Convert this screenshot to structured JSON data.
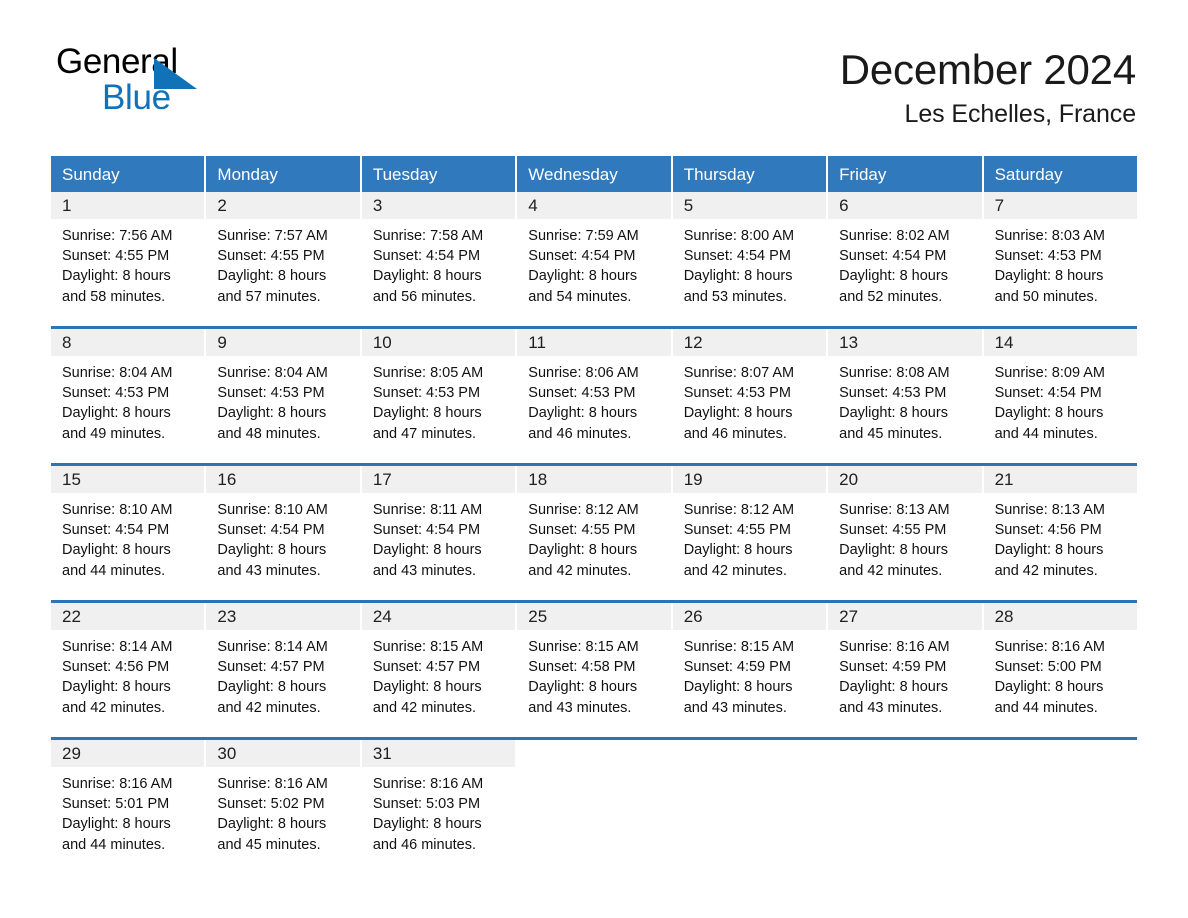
{
  "logo": {
    "text_primary": "General",
    "text_secondary": "Blue",
    "primary_color": "#000000",
    "secondary_color": "#1272b8"
  },
  "header": {
    "title": "December 2024",
    "subtitle": "Les Echelles, France"
  },
  "theme": {
    "header_blue": "#3079bd",
    "rule_blue": "#2e74b5",
    "daynum_band": "#f0f0f0",
    "text": "#111111"
  },
  "calendar": {
    "day_headers": [
      "Sunday",
      "Monday",
      "Tuesday",
      "Wednesday",
      "Thursday",
      "Friday",
      "Saturday"
    ],
    "weeks": [
      [
        {
          "day": "1",
          "sunrise": "Sunrise: 7:56 AM",
          "sunset": "Sunset: 4:55 PM",
          "daylight_line1": "Daylight: 8 hours",
          "daylight_line2": "and 58 minutes."
        },
        {
          "day": "2",
          "sunrise": "Sunrise: 7:57 AM",
          "sunset": "Sunset: 4:55 PM",
          "daylight_line1": "Daylight: 8 hours",
          "daylight_line2": "and 57 minutes."
        },
        {
          "day": "3",
          "sunrise": "Sunrise: 7:58 AM",
          "sunset": "Sunset: 4:54 PM",
          "daylight_line1": "Daylight: 8 hours",
          "daylight_line2": "and 56 minutes."
        },
        {
          "day": "4",
          "sunrise": "Sunrise: 7:59 AM",
          "sunset": "Sunset: 4:54 PM",
          "daylight_line1": "Daylight: 8 hours",
          "daylight_line2": "and 54 minutes."
        },
        {
          "day": "5",
          "sunrise": "Sunrise: 8:00 AM",
          "sunset": "Sunset: 4:54 PM",
          "daylight_line1": "Daylight: 8 hours",
          "daylight_line2": "and 53 minutes."
        },
        {
          "day": "6",
          "sunrise": "Sunrise: 8:02 AM",
          "sunset": "Sunset: 4:54 PM",
          "daylight_line1": "Daylight: 8 hours",
          "daylight_line2": "and 52 minutes."
        },
        {
          "day": "7",
          "sunrise": "Sunrise: 8:03 AM",
          "sunset": "Sunset: 4:53 PM",
          "daylight_line1": "Daylight: 8 hours",
          "daylight_line2": "and 50 minutes."
        }
      ],
      [
        {
          "day": "8",
          "sunrise": "Sunrise: 8:04 AM",
          "sunset": "Sunset: 4:53 PM",
          "daylight_line1": "Daylight: 8 hours",
          "daylight_line2": "and 49 minutes."
        },
        {
          "day": "9",
          "sunrise": "Sunrise: 8:04 AM",
          "sunset": "Sunset: 4:53 PM",
          "daylight_line1": "Daylight: 8 hours",
          "daylight_line2": "and 48 minutes."
        },
        {
          "day": "10",
          "sunrise": "Sunrise: 8:05 AM",
          "sunset": "Sunset: 4:53 PM",
          "daylight_line1": "Daylight: 8 hours",
          "daylight_line2": "and 47 minutes."
        },
        {
          "day": "11",
          "sunrise": "Sunrise: 8:06 AM",
          "sunset": "Sunset: 4:53 PM",
          "daylight_line1": "Daylight: 8 hours",
          "daylight_line2": "and 46 minutes."
        },
        {
          "day": "12",
          "sunrise": "Sunrise: 8:07 AM",
          "sunset": "Sunset: 4:53 PM",
          "daylight_line1": "Daylight: 8 hours",
          "daylight_line2": "and 46 minutes."
        },
        {
          "day": "13",
          "sunrise": "Sunrise: 8:08 AM",
          "sunset": "Sunset: 4:53 PM",
          "daylight_line1": "Daylight: 8 hours",
          "daylight_line2": "and 45 minutes."
        },
        {
          "day": "14",
          "sunrise": "Sunrise: 8:09 AM",
          "sunset": "Sunset: 4:54 PM",
          "daylight_line1": "Daylight: 8 hours",
          "daylight_line2": "and 44 minutes."
        }
      ],
      [
        {
          "day": "15",
          "sunrise": "Sunrise: 8:10 AM",
          "sunset": "Sunset: 4:54 PM",
          "daylight_line1": "Daylight: 8 hours",
          "daylight_line2": "and 44 minutes."
        },
        {
          "day": "16",
          "sunrise": "Sunrise: 8:10 AM",
          "sunset": "Sunset: 4:54 PM",
          "daylight_line1": "Daylight: 8 hours",
          "daylight_line2": "and 43 minutes."
        },
        {
          "day": "17",
          "sunrise": "Sunrise: 8:11 AM",
          "sunset": "Sunset: 4:54 PM",
          "daylight_line1": "Daylight: 8 hours",
          "daylight_line2": "and 43 minutes."
        },
        {
          "day": "18",
          "sunrise": "Sunrise: 8:12 AM",
          "sunset": "Sunset: 4:55 PM",
          "daylight_line1": "Daylight: 8 hours",
          "daylight_line2": "and 42 minutes."
        },
        {
          "day": "19",
          "sunrise": "Sunrise: 8:12 AM",
          "sunset": "Sunset: 4:55 PM",
          "daylight_line1": "Daylight: 8 hours",
          "daylight_line2": "and 42 minutes."
        },
        {
          "day": "20",
          "sunrise": "Sunrise: 8:13 AM",
          "sunset": "Sunset: 4:55 PM",
          "daylight_line1": "Daylight: 8 hours",
          "daylight_line2": "and 42 minutes."
        },
        {
          "day": "21",
          "sunrise": "Sunrise: 8:13 AM",
          "sunset": "Sunset: 4:56 PM",
          "daylight_line1": "Daylight: 8 hours",
          "daylight_line2": "and 42 minutes."
        }
      ],
      [
        {
          "day": "22",
          "sunrise": "Sunrise: 8:14 AM",
          "sunset": "Sunset: 4:56 PM",
          "daylight_line1": "Daylight: 8 hours",
          "daylight_line2": "and 42 minutes."
        },
        {
          "day": "23",
          "sunrise": "Sunrise: 8:14 AM",
          "sunset": "Sunset: 4:57 PM",
          "daylight_line1": "Daylight: 8 hours",
          "daylight_line2": "and 42 minutes."
        },
        {
          "day": "24",
          "sunrise": "Sunrise: 8:15 AM",
          "sunset": "Sunset: 4:57 PM",
          "daylight_line1": "Daylight: 8 hours",
          "daylight_line2": "and 42 minutes."
        },
        {
          "day": "25",
          "sunrise": "Sunrise: 8:15 AM",
          "sunset": "Sunset: 4:58 PM",
          "daylight_line1": "Daylight: 8 hours",
          "daylight_line2": "and 43 minutes."
        },
        {
          "day": "26",
          "sunrise": "Sunrise: 8:15 AM",
          "sunset": "Sunset: 4:59 PM",
          "daylight_line1": "Daylight: 8 hours",
          "daylight_line2": "and 43 minutes."
        },
        {
          "day": "27",
          "sunrise": "Sunrise: 8:16 AM",
          "sunset": "Sunset: 4:59 PM",
          "daylight_line1": "Daylight: 8 hours",
          "daylight_line2": "and 43 minutes."
        },
        {
          "day": "28",
          "sunrise": "Sunrise: 8:16 AM",
          "sunset": "Sunset: 5:00 PM",
          "daylight_line1": "Daylight: 8 hours",
          "daylight_line2": "and 44 minutes."
        }
      ],
      [
        {
          "day": "29",
          "sunrise": "Sunrise: 8:16 AM",
          "sunset": "Sunset: 5:01 PM",
          "daylight_line1": "Daylight: 8 hours",
          "daylight_line2": "and 44 minutes."
        },
        {
          "day": "30",
          "sunrise": "Sunrise: 8:16 AM",
          "sunset": "Sunset: 5:02 PM",
          "daylight_line1": "Daylight: 8 hours",
          "daylight_line2": "and 45 minutes."
        },
        {
          "day": "31",
          "sunrise": "Sunrise: 8:16 AM",
          "sunset": "Sunset: 5:03 PM",
          "daylight_line1": "Daylight: 8 hours",
          "daylight_line2": "and 46 minutes."
        },
        {
          "day": "",
          "sunrise": "",
          "sunset": "",
          "daylight_line1": "",
          "daylight_line2": ""
        },
        {
          "day": "",
          "sunrise": "",
          "sunset": "",
          "daylight_line1": "",
          "daylight_line2": ""
        },
        {
          "day": "",
          "sunrise": "",
          "sunset": "",
          "daylight_line1": "",
          "daylight_line2": ""
        },
        {
          "day": "",
          "sunrise": "",
          "sunset": "",
          "daylight_line1": "",
          "daylight_line2": ""
        }
      ]
    ]
  }
}
